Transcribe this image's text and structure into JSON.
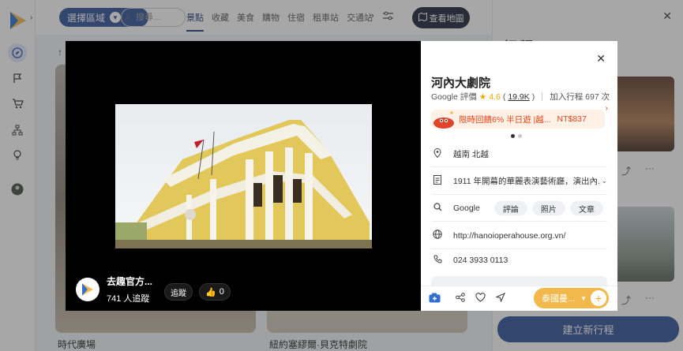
{
  "topbar": {
    "region_button": "選擇區域",
    "search_placeholder": "搜尋...",
    "categories": [
      "景點",
      "收藏",
      "美食",
      "購物",
      "住宿",
      "租車站",
      "交通站"
    ],
    "more": "›",
    "map_button": "查看地圖"
  },
  "results": {
    "cards": [
      {
        "title": "時代廣場"
      },
      {
        "title": "紐約塞繆爾·貝克特劇院"
      }
    ]
  },
  "right_panel": {
    "title": "行程",
    "new_trip_button": "建立新行程"
  },
  "viewer": {
    "poster_name": "去趣官方...",
    "poster_followers": "741 人追蹤",
    "follow_button": "追蹤",
    "like_count": "0"
  },
  "info": {
    "title": "河內大劇院",
    "rating_prefix": "Google 評價",
    "rating_value": "4.6",
    "rating_open": "(",
    "rating_count": "19.9K",
    "rating_close": ")",
    "added_to_trips": "加入行程 697 次",
    "promo_text": "限時回饋6% 半日遊 |越...",
    "promo_price": "NT$837",
    "location": "越南 北越",
    "description": "1911 年開幕的華麗表演藝術廳，演出內...",
    "google_label": "Google",
    "tags": [
      "評論",
      "照片",
      "文章"
    ],
    "website": "http://hanoioperahouse.org.vn/",
    "phone": "024 3933 0113",
    "trip_select": "泰國曼..."
  },
  "colors": {
    "brand_navy": "#2d4f95",
    "map_button_bg": "#1a2238",
    "promo_bg": "#fff1e6",
    "promo_text": "#e0441a",
    "trip_select_bg": "#f2b84b",
    "rating_star": "#f0a500"
  },
  "icons": {
    "sidebar": [
      "compass-icon",
      "flag-icon",
      "cart-icon",
      "sitemap-icon",
      "bulb-icon",
      "avatar"
    ],
    "info_rows": [
      "location-pin-icon",
      "document-icon",
      "search-icon",
      "globe-icon",
      "phone-icon"
    ],
    "action_bar": [
      "add-photo-icon",
      "share-icon",
      "heart-icon",
      "navigate-icon",
      "plus-icon"
    ]
  }
}
